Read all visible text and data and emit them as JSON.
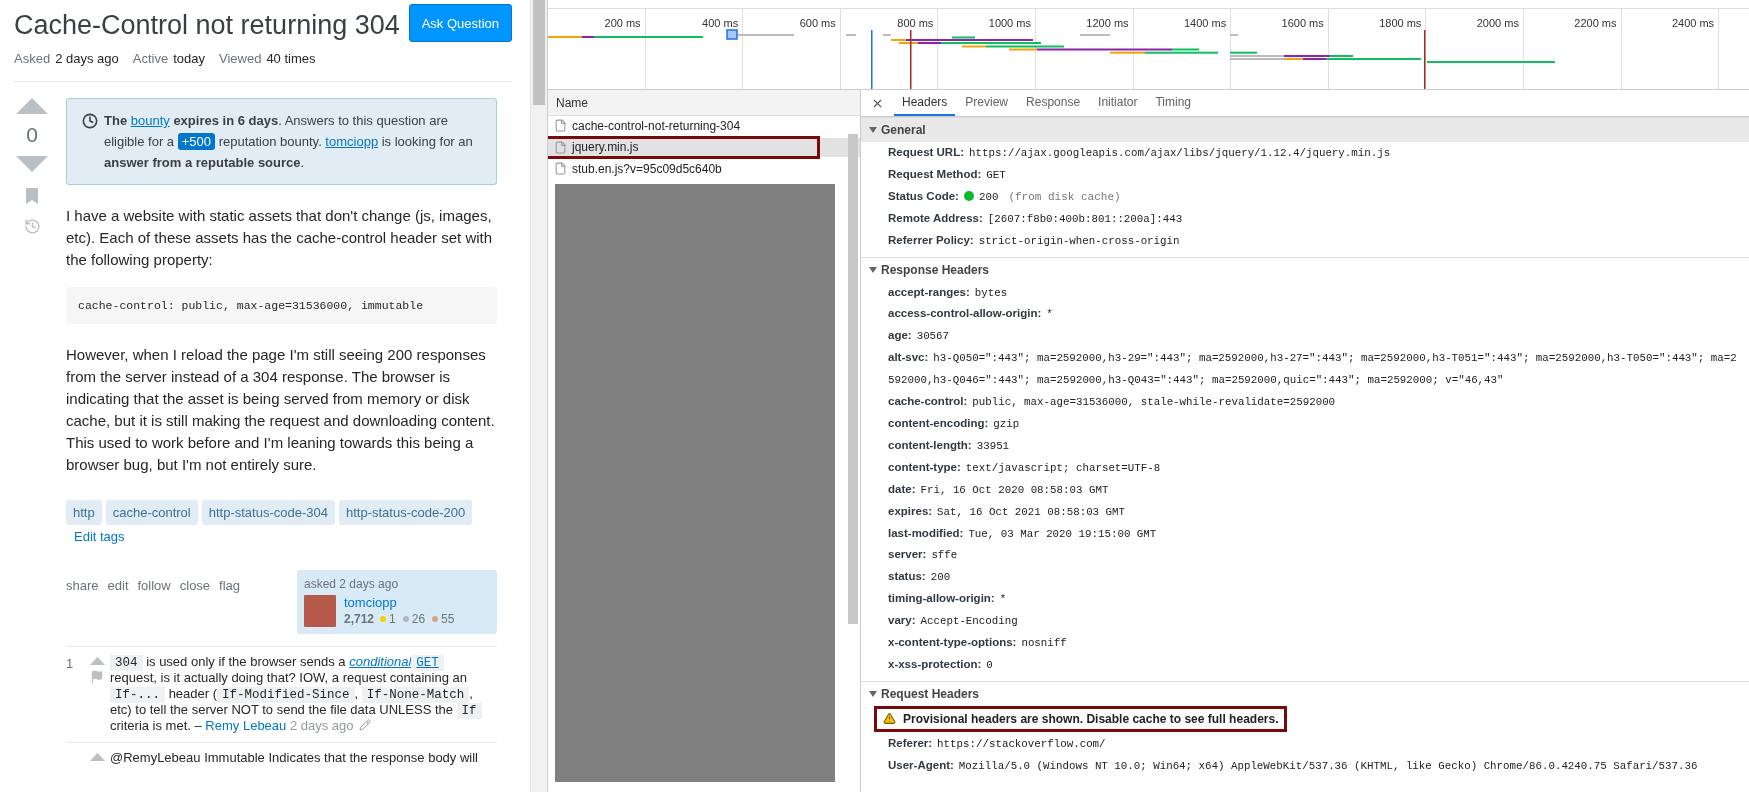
{
  "question": {
    "title": "Cache-Control not returning 304",
    "ask_button": "Ask Question",
    "meta": [
      {
        "label": "Asked",
        "value": "2 days ago"
      },
      {
        "label": "Active",
        "value": "today"
      },
      {
        "label": "Viewed",
        "value": "40 times"
      }
    ],
    "score": "0",
    "bounty_notice": [
      {
        "kind": "bold",
        "text": "The "
      },
      {
        "kind": "link",
        "text": "bounty"
      },
      {
        "kind": "bold",
        "text": " expires in 6 days"
      },
      {
        "kind": "text",
        "text": ". Answers to this question are eligible for a "
      },
      {
        "kind": "badge",
        "text": "+500"
      },
      {
        "kind": "text",
        "text": " reputation bounty. "
      },
      {
        "kind": "link",
        "text": "tomciopp"
      },
      {
        "kind": "text",
        "text": " is looking for an "
      },
      {
        "kind": "bold",
        "text": "answer from a reputable source"
      },
      {
        "kind": "text",
        "text": "."
      }
    ],
    "body": [
      {
        "kind": "paragraph",
        "text": "I have a website with static assets that don't change (js, images, etc). Each of these assets has the cache-control header set with the following property:"
      },
      {
        "kind": "code",
        "text": "cache-control: public, max-age=31536000, immutable"
      },
      {
        "kind": "paragraph",
        "text": "However, when I reload the page I'm still seeing 200 responses from the server instead of a 304 response. The browser is indicating that the asset is being served from memory or disk cache, but it is still making the request and downloading content. This used to work before and I'm leaning towards this being a browser bug, but I'm not entirely sure."
      }
    ],
    "tags": [
      "http",
      "cache-control",
      "http-status-code-304",
      "http-status-code-200"
    ],
    "edit_tags": "Edit tags",
    "actions": [
      "share",
      "edit",
      "follow",
      "close",
      "flag"
    ],
    "asked_card": {
      "label": "asked 2 days ago",
      "user": "tomciopp",
      "reputation": "2,712",
      "badges": [
        {
          "color": "#ffcc01",
          "count": "1"
        },
        {
          "color": "#b4b8bc",
          "count": "26"
        },
        {
          "color": "#d1a684",
          "count": "55"
        }
      ]
    },
    "comments": [
      {
        "score": "1",
        "flag": true,
        "segments": [
          {
            "kind": "code",
            "text": "304"
          },
          {
            "kind": "text",
            "text": " is used only if the browser sends a "
          },
          {
            "kind": "italic-link",
            "text": "conditional"
          },
          {
            "kind": "code-link",
            "text": "GET"
          },
          {
            "kind": "text",
            "text": " request, is it actually doing that? IOW, a request containing an "
          },
          {
            "kind": "code",
            "text": "If-..."
          },
          {
            "kind": "text",
            "text": " header ("
          },
          {
            "kind": "code",
            "text": "If-Modified-Since"
          },
          {
            "kind": "text",
            "text": ", "
          },
          {
            "kind": "code",
            "text": "If-None-Match"
          },
          {
            "kind": "text",
            "text": ", etc) to tell the server NOT to send the file data UNLESS the "
          },
          {
            "kind": "code",
            "text": "If"
          },
          {
            "kind": "text",
            "text": " criteria is met. – "
          },
          {
            "kind": "author",
            "text": "Remy Lebeau"
          },
          {
            "kind": "time",
            "text": "2 days ago"
          }
        ],
        "edited": true
      },
      {
        "flag": false,
        "segments": [
          {
            "kind": "text",
            "text": "@RemyLebeau Immutable Indicates that the response body will"
          }
        ],
        "edited": false
      }
    ]
  },
  "devtools": {
    "timeline": {
      "ticks": [
        "200 ms",
        "400 ms",
        "600 ms",
        "800 ms",
        "1000 ms",
        "1200 ms",
        "1400 ms",
        "1600 ms",
        "1800 ms",
        "2000 ms",
        "2200 ms",
        "2400 ms"
      ]
    },
    "requests": {
      "column": "Name",
      "rows": [
        {
          "name": "cache-control-not-returning-304",
          "selected": false
        },
        {
          "name": "jquery.min.js",
          "selected": true
        },
        {
          "name": "stub.en.js?v=95c09d5c640b",
          "selected": false
        }
      ]
    },
    "detail": {
      "tabs": [
        {
          "label": "Headers",
          "selected": true
        },
        {
          "label": "Preview",
          "selected": false
        },
        {
          "label": "Response",
          "selected": false
        },
        {
          "label": "Initiator",
          "selected": false
        },
        {
          "label": "Timing",
          "selected": false
        }
      ],
      "sections": [
        {
          "title": "General",
          "expanded": true,
          "focused": true,
          "rows": [
            {
              "kind": "plain",
              "label": "Request URL:",
              "value": "https://ajax.googleapis.com/ajax/libs/jquery/1.12.4/jquery.min.js"
            },
            {
              "kind": "plain",
              "label": "Request Method:",
              "value": "GET"
            },
            {
              "kind": "status",
              "label": "Status Code:",
              "value": "200",
              "note": "(from disk cache)"
            },
            {
              "kind": "plain",
              "label": "Remote Address:",
              "value": "[2607:f8b0:400b:801::200a]:443"
            },
            {
              "kind": "plain",
              "label": "Referrer Policy:",
              "value": "strict-origin-when-cross-origin"
            }
          ]
        },
        {
          "title": "Response Headers",
          "expanded": true,
          "focused": false,
          "rows": [
            {
              "kind": "plain",
              "label": "accept-ranges:",
              "value": "bytes"
            },
            {
              "kind": "plain",
              "label": "access-control-allow-origin:",
              "value": "*"
            },
            {
              "kind": "plain",
              "label": "age:",
              "value": "30567"
            },
            {
              "kind": "wrapped",
              "label": "alt-svc:",
              "value_lines": [
                "h3-Q050=\":443\"; ma=2592000,h3-29=\":443\"; ma=2592000,h3-27=\":443\"; ma=2592000,h3-T051=\":443\"; ma=2592000,h3-T050=\":443\"; ma=2",
                "592000,h3-Q046=\":443\"; ma=2592000,h3-Q043=\":443\"; ma=2592000,quic=\":443\"; ma=2592000; v=\"46,43\""
              ]
            },
            {
              "kind": "plain",
              "label": "cache-control:",
              "value": "public, max-age=31536000, stale-while-revalidate=2592000"
            },
            {
              "kind": "plain",
              "label": "content-encoding:",
              "value": "gzip"
            },
            {
              "kind": "plain",
              "label": "content-length:",
              "value": "33951"
            },
            {
              "kind": "plain",
              "label": "content-type:",
              "value": "text/javascript; charset=UTF-8"
            },
            {
              "kind": "plain",
              "label": "date:",
              "value": "Fri, 16 Oct 2020 08:58:03 GMT"
            },
            {
              "kind": "plain",
              "label": "expires:",
              "value": "Sat, 16 Oct 2021 08:58:03 GMT"
            },
            {
              "kind": "plain",
              "label": "last-modified:",
              "value": "Tue, 03 Mar 2020 19:15:00 GMT"
            },
            {
              "kind": "plain",
              "label": "server:",
              "value": "sffe"
            },
            {
              "kind": "plain",
              "label": "status:",
              "value": "200"
            },
            {
              "kind": "plain",
              "label": "timing-allow-origin:",
              "value": "*"
            },
            {
              "kind": "plain",
              "label": "vary:",
              "value": "Accept-Encoding"
            },
            {
              "kind": "plain",
              "label": "x-content-type-options:",
              "value": "nosniff"
            },
            {
              "kind": "plain",
              "label": "x-xss-protection:",
              "value": "0"
            }
          ]
        },
        {
          "title": "Request Headers",
          "expanded": true,
          "focused": false,
          "rows": [
            {
              "kind": "warning",
              "text": "Provisional headers are shown. Disable cache to see full headers."
            },
            {
              "kind": "plain",
              "label": "Referer:",
              "value": "https://stackoverflow.com/"
            },
            {
              "kind": "plain",
              "label": "User-Agent:",
              "value": "Mozilla/5.0 (Windows NT 10.0; Win64; x64) AppleWebKit/537.36 (KHTML, like Gecko) Chrome/86.0.4240.75 Safari/537.36"
            }
          ]
        }
      ]
    }
  }
}
